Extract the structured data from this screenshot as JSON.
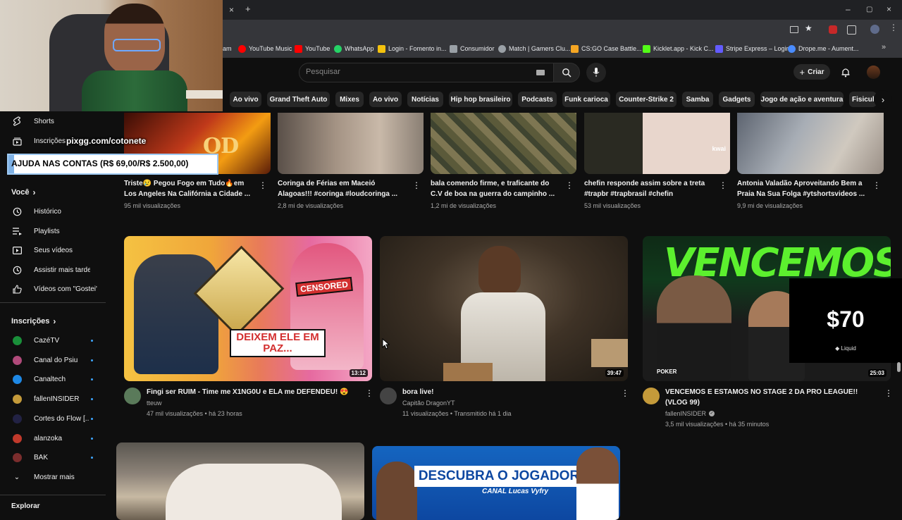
{
  "browser": {
    "tab_close": "×",
    "tab_new": "+",
    "window_controls": [
      "–",
      "▢",
      "×"
    ],
    "bookmarks": [
      {
        "label": "am",
        "color": "#35363a"
      },
      {
        "label": "YouTube Music",
        "color": "#ff0000"
      },
      {
        "label": "YouTube",
        "color": "#ff0000"
      },
      {
        "label": "WhatsApp",
        "color": "#25d366"
      },
      {
        "label": "Login - Fomento in...",
        "color": "#f4c20d"
      },
      {
        "label": "Consumidor",
        "color": "#9aa0a6"
      },
      {
        "label": "Match | Gamers Clu...",
        "color": "#9aa0a6"
      },
      {
        "label": "CS:GO Case Battle...",
        "color": "#f5a623"
      },
      {
        "label": "Kicklet.app - Kick C...",
        "color": "#53fc18"
      },
      {
        "label": "Stripe Express – Login",
        "color": "#635bff"
      },
      {
        "label": "Drope.me - Aument...",
        "color": "#4a8cff"
      }
    ]
  },
  "header": {
    "search_placeholder": "Pesquisar",
    "create_label": "Criar"
  },
  "chips": [
    "Ao vivo",
    "Grand Theft Auto",
    "Mixes",
    "Ao vivo",
    "Notícias",
    "Hip hop brasileiro",
    "Podcasts",
    "Funk carioca",
    "Counter-Strike 2",
    "Samba",
    "Gadgets",
    "Jogo de ação e aventura",
    "Fisicul"
  ],
  "overlay": {
    "link_text": "pixgg.com/cotonete",
    "goal_text": "AJUDA NAS CONTAS (R$ 69,00/R$ 2.500,00)",
    "goal_progress": 0.0276,
    "donation_amount": "$70",
    "donation_brand": "Liquid"
  },
  "sidebar": {
    "top_items": [
      {
        "label": "Shorts",
        "icon": "shorts-icon"
      },
      {
        "label": "Inscrições",
        "icon": "subscriptions-icon"
      }
    ],
    "you_heading": "Você",
    "you_items": [
      {
        "label": "Histórico",
        "icon": "history-icon"
      },
      {
        "label": "Playlists",
        "icon": "playlists-icon"
      },
      {
        "label": "Seus vídeos",
        "icon": "your-videos-icon"
      },
      {
        "label": "Assistir mais tarde",
        "icon": "watch-later-icon"
      },
      {
        "label": "Vídeos com \"Gostei\"",
        "icon": "liked-icon"
      }
    ],
    "subs_heading": "Inscrições",
    "subscriptions": [
      {
        "label": "CazéTV",
        "color": "#1a8f3a"
      },
      {
        "label": "Canal do Psiu",
        "color": "#b04a7a"
      },
      {
        "label": "Canaltech",
        "color": "#1e88e5"
      },
      {
        "label": "fallenINSIDER",
        "color": "#c49a3a"
      },
      {
        "label": "Cortes do Flow [..",
        "color": "#222244"
      },
      {
        "label": "alanzoka",
        "color": "#c0392b"
      },
      {
        "label": "BAK",
        "color": "#7b2d2d"
      }
    ],
    "show_more": "Mostrar mais",
    "explore": "Explorar"
  },
  "row1": [
    {
      "title": "Triste😢 Pegou Fogo em Tudo🔥em Los Angeles Na Califórnia a Cidade ...",
      "meta": "95 mil visualizações",
      "thumb": "#c0391a"
    },
    {
      "title": "Coringa de Férias em Maceió Alagoas!!! #coringa #loudcoringa ...",
      "meta": "2,8 mi de visualizações",
      "thumb": "#8a7f74"
    },
    {
      "title": "bala comendo firme, e traficante do C.V de boa na guerra do campinho ...",
      "meta": "1,2 mi de visualizações",
      "thumb": "#6f6b4a"
    },
    {
      "title": "chefin responde assim sobre a treta #trapbr #trapbrasil #chefin",
      "meta": "53 mil visualizações",
      "thumb": "#b8a294",
      "badge": "kwai"
    },
    {
      "title": "Antonia Valadão Aproveitando Bem a Praia Na Sua Folga #ytshortsvideos ...",
      "meta": "9,9 mi de visualizações",
      "thumb": "#9aa0a6"
    }
  ],
  "row2": [
    {
      "title": "Fingi ser RUIM - Time me X1NG0U e ELA me DEFENDEU! 😍",
      "channel": "tteuw",
      "meta": "47 mil visualizações • há 23 horas",
      "duration": "13:12",
      "overlay1": "DEIXEM ELE EM PAZ...",
      "overlay2": "CENSORED",
      "avatar": "#5a7a5a"
    },
    {
      "title": "bora live!",
      "channel": "Capitão DragonYT",
      "meta": "11 visualizações • Transmitido há 1 dia",
      "duration": "39:47",
      "avatar": "#444"
    },
    {
      "title": "VENCEMOS E ESTAMOS NO STAGE 2 DA PRO LEAGUE!! (VLOG 99)",
      "channel": "fallenINSIDER",
      "meta": "3,5 mil visualizações • há 35 minutos",
      "duration": "25:03",
      "overlay1": "VENCEMOS",
      "overlay2": "POKER",
      "avatar": "#c49a3a"
    }
  ],
  "row3": [
    {
      "thumb": "#8c8278"
    },
    {
      "overlay1": "DESCUBRA O JOGADOR",
      "overlay2": "CANAL Lucas Vyfry"
    }
  ]
}
